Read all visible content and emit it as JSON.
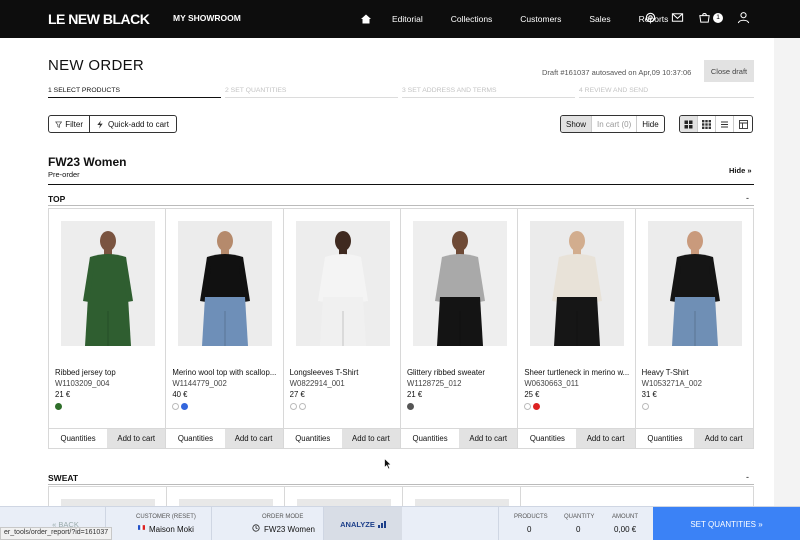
{
  "header": {
    "logo": "LE NEW BLACK",
    "showroom": "MY SHOWROOM",
    "nav": [
      "Editorial",
      "Collections",
      "Customers",
      "Sales",
      "Reports"
    ],
    "cart_count": "1"
  },
  "order": {
    "title": "NEW ORDER",
    "draft_note": "Draft #161037 autosaved on Apr,09 10:37:06",
    "close_draft": "Close draft",
    "steps": [
      "1 SELECT PRODUCTS",
      "2 SET QUANTITIES",
      "3 SET ADDRESS AND TERMS",
      "4 REVIEW AND SEND"
    ]
  },
  "toolbar": {
    "filter": "Filter",
    "quick_add": "Quick-add to cart",
    "show": "Show",
    "in_cart": "In cart (0)",
    "hide": "Hide"
  },
  "collection": {
    "title": "FW23 Women",
    "subtitle": "Pre-order",
    "hide_link": "Hide »"
  },
  "sections": {
    "top": "TOP",
    "sweat": "SWEAT",
    "toggle": "-"
  },
  "products": [
    {
      "name": "Ribbed jersey top",
      "sku": "W1103209_004",
      "price": "21 €",
      "swatches": [
        "#2f6e2a"
      ],
      "top": "#2f5e30",
      "bottom": "#2f5e30",
      "skin": "#7a5440",
      "bg": "#ededed"
    },
    {
      "name": "Merino wool top with scallop...",
      "sku": "W1144779_002",
      "price": "40 €",
      "swatches": [
        "#ffffff",
        "#3366dd"
      ],
      "top": "#111111",
      "bottom": "#6e8fb8",
      "skin": "#b58a6c",
      "bg": "#ececec"
    },
    {
      "name": "Longsleeves T-Shirt",
      "sku": "W0822914_001",
      "price": "27 €",
      "swatches": [
        "#ffffff",
        "#ffffff"
      ],
      "top": "#f4f4f4",
      "bottom": "#f0f0f0",
      "skin": "#3f2a20",
      "bg": "#ededed"
    },
    {
      "name": "Glittery ribbed sweater",
      "sku": "W1128725_012",
      "price": "21 €",
      "swatches": [
        "#555555"
      ],
      "top": "#a9a9a9",
      "bottom": "#141414",
      "skin": "#6e4a36",
      "bg": "#eeeeee"
    },
    {
      "name": "Sheer turtleneck in merino w...",
      "sku": "W0630663_011",
      "price": "25 €",
      "swatches": [
        "#ffffff",
        "#dd2222"
      ],
      "top": "#e8e2d8",
      "bottom": "#161616",
      "skin": "#d2ad8e",
      "bg": "#ebebeb"
    },
    {
      "name": "Heavy T-Shirt",
      "sku": "W1053271A_002",
      "price": "31 €",
      "swatches": [
        "#ffffff"
      ],
      "top": "#151515",
      "bottom": "#6f8fb5",
      "skin": "#c99a7c",
      "bg": "#ececec"
    }
  ],
  "card_actions": {
    "quantities": "Quantities",
    "add": "Add to cart"
  },
  "bottom": {
    "back": "« BACK",
    "customer_label": "CUSTOMER (RESET)",
    "customer_value": "Maison Moki",
    "order_mode_label": "ORDER MODE",
    "order_mode_value": "FW23 Women",
    "analyze": "ANALYZE",
    "products_label": "PRODUCTS",
    "products_value": "0",
    "quantity_label": "QUANTITY",
    "quantity_value": "0",
    "amount_label": "AMOUNT",
    "amount_value": "0,00 €",
    "set_quantities": "SET QUANTITIES »"
  },
  "url_tip": "er_tools/order_report/?id=161037"
}
